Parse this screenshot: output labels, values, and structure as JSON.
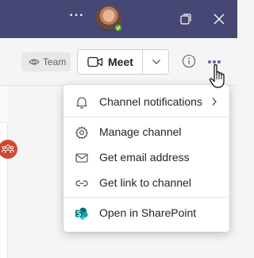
{
  "titlebar": {
    "more_label": "···",
    "avatar_icon": "user-avatar",
    "presence_status": "available",
    "presence_color": "#6bb700",
    "restore_icon": "restore-window-icon",
    "close_icon": "close-icon",
    "background": "#464775"
  },
  "header": {
    "team_label": "Team",
    "meet_label": "Meet",
    "video_icon": "video-camera-icon",
    "caret_icon": "chevron-down-icon",
    "info_icon": "info-icon",
    "more_icon": "more-options-icon"
  },
  "channel_menu": {
    "items": [
      {
        "label": "Channel notifications",
        "icon": "bell-icon",
        "has_submenu": true
      },
      {
        "label": "Manage channel",
        "icon": "gear-icon"
      },
      {
        "label": "Get email address",
        "icon": "envelope-icon"
      },
      {
        "label": "Get link to channel",
        "icon": "link-icon"
      },
      {
        "label": "Open in SharePoint",
        "icon": "sharepoint-icon"
      }
    ]
  },
  "colors": {
    "accent": "#6264a7",
    "sharepoint": "#038387",
    "team_avatar": "#cc4a31"
  }
}
